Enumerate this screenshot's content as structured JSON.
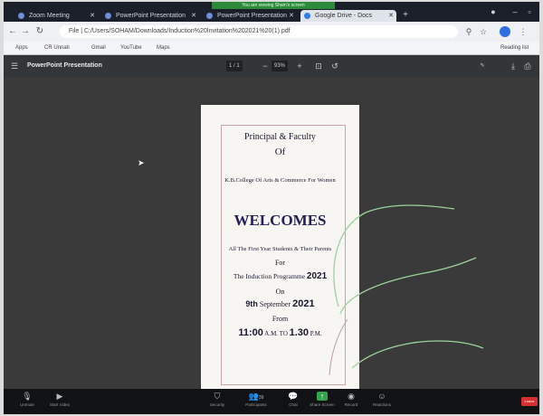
{
  "zoom_banner": "You are viewing Sham's screen",
  "tabs": [
    {
      "label": "Zoom Meeting",
      "active": false
    },
    {
      "label": "PowerPoint Presentation",
      "active": false
    },
    {
      "label": "PowerPoint Presentation",
      "active": false
    },
    {
      "label": "Google Drive - Docs",
      "active": true
    }
  ],
  "address": {
    "url": "File | C:/Users/SOHAM/Downloads/Induction%20Invitation%202021%20(1).pdf"
  },
  "bookmarks": [
    {
      "label": "Apps",
      "color": "#6b7a99"
    },
    {
      "label": "CR Unnati",
      "color": "#3b7ddd"
    },
    {
      "label": "Gmail",
      "color": "#d93025"
    },
    {
      "label": "YouTube",
      "color": "#e62117"
    },
    {
      "label": "Maps",
      "color": "#1a73e8"
    },
    {
      "label": "Reading list",
      "color": "#777777"
    }
  ],
  "pdf": {
    "title": "PowerPoint Presentation",
    "page": "1 / 1",
    "zoom": "93%"
  },
  "page_lines": [
    "Principal & Faculty",
    "Of",
    "K.B.College Of Arts & Commerce For Women",
    "WELCOMES",
    "All The First Year Students & Their Parents",
    "For",
    "The Induction Programme",
    "2021",
    "On",
    "9th",
    "September",
    "2021",
    "From",
    "11:00",
    "A.M. TO",
    "1.30",
    "P.M."
  ],
  "meeting_bar": {
    "buttons": [
      "Unmute",
      "Start Video",
      "Security",
      "Participants",
      "Chat",
      "Share Screen",
      "Record",
      "Reactions"
    ],
    "participants_count": "39",
    "leave": "Leave"
  },
  "colors": {
    "scribble": "#9bd49b",
    "leave": "#d3302f",
    "share": "#2fa64b"
  }
}
